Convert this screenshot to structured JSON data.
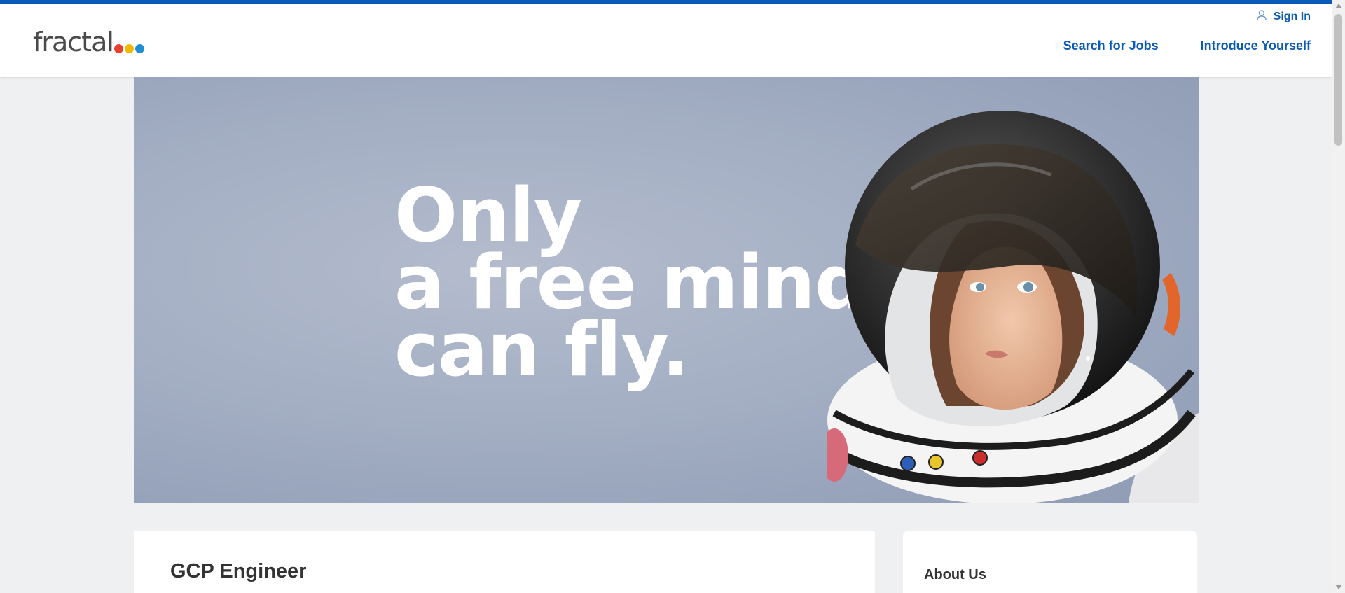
{
  "header": {
    "logo": {
      "text": "fractal",
      "dot_colors": [
        "#e8402f",
        "#f5b800",
        "#1f8fd1"
      ]
    },
    "sign_in_label": "Sign In",
    "nav": [
      "Search for Jobs",
      "Introduce Yourself"
    ],
    "accent_color": "#0a5bb8"
  },
  "hero": {
    "lines": [
      "Only",
      "a free mind",
      "can fly."
    ]
  },
  "job": {
    "title": "GCP Engineer"
  },
  "sidebar": {
    "title": "About Us"
  }
}
